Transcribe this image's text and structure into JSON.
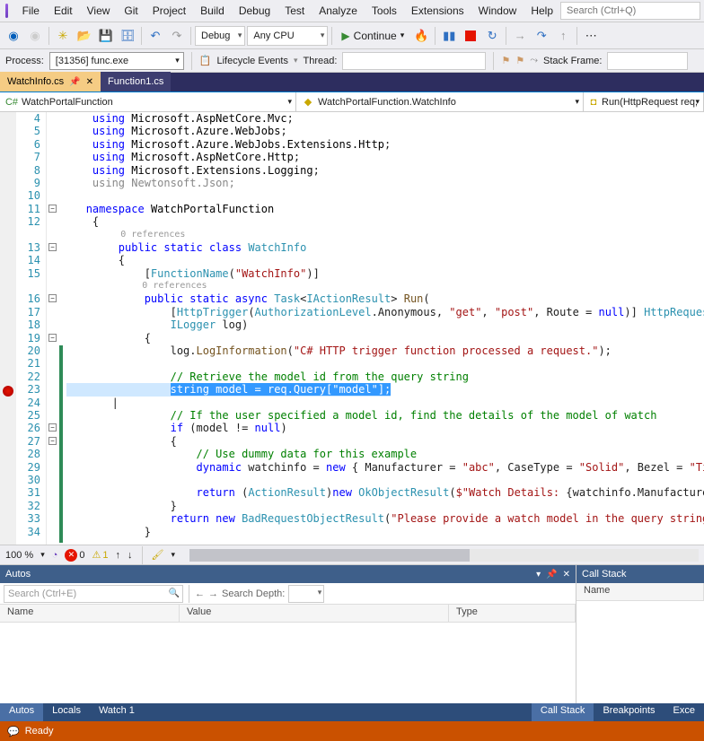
{
  "menu": [
    "File",
    "Edit",
    "View",
    "Git",
    "Project",
    "Build",
    "Debug",
    "Test",
    "Analyze",
    "Tools",
    "Extensions",
    "Window",
    "Help"
  ],
  "search_placeholder": "Search (Ctrl+Q)",
  "toolbar": {
    "config": "Debug",
    "platform": "Any CPU",
    "continue": "Continue"
  },
  "process": {
    "label": "Process:",
    "value": "[31356] func.exe",
    "lifecycle_label": "Lifecycle Events",
    "thread_label": "Thread:",
    "stack_label": "Stack Frame:"
  },
  "tabs": [
    {
      "name": "WatchInfo.cs",
      "active": true
    },
    {
      "name": "Function1.cs",
      "active": false
    }
  ],
  "dropdowns": {
    "namespace": "WatchPortalFunction",
    "class": "WatchPortalFunction.WatchInfo",
    "method": "Run(HttpRequest req,"
  },
  "code": {
    "first_line": 4,
    "breakpoint_line": 23,
    "change_bar_start": 20,
    "change_bar_end": 34,
    "lines": [
      {
        "n": 4,
        "t": "    using Microsoft.AspNetCore.Mvc;",
        "cls": "u"
      },
      {
        "n": 5,
        "t": "    using Microsoft.Azure.WebJobs;",
        "cls": "u"
      },
      {
        "n": 6,
        "t": "    using Microsoft.Azure.WebJobs.Extensions.Http;",
        "cls": "u"
      },
      {
        "n": 7,
        "t": "    using Microsoft.AspNetCore.Http;",
        "cls": "u"
      },
      {
        "n": 8,
        "t": "    using Microsoft.Extensions.Logging;",
        "cls": "u"
      },
      {
        "n": 9,
        "t": "    using Newtonsoft.Json;",
        "cls": "ug"
      },
      {
        "n": 10,
        "t": ""
      },
      {
        "n": 11,
        "t": "   ⊟namespace WatchPortalFunction",
        "cls": "ns"
      },
      {
        "n": 12,
        "t": "    {"
      },
      {
        "n": 0,
        "t": "          0 references",
        "cls": "ref"
      },
      {
        "n": 13,
        "t": "        public static class WatchInfo",
        "cls": "cls"
      },
      {
        "n": 14,
        "t": "        {"
      },
      {
        "n": 15,
        "t": "            [FunctionName(\"WatchInfo\")]",
        "cls": "attr"
      },
      {
        "n": 0,
        "t": "              0 references",
        "cls": "ref"
      },
      {
        "n": 16,
        "t": "            public static async Task<IActionResult> Run(",
        "cls": "sig"
      },
      {
        "n": 17,
        "t": "                [HttpTrigger(AuthorizationLevel.Anonymous, \"get\", \"post\", Route = null)] HttpRequest req,",
        "cls": "p1"
      },
      {
        "n": 18,
        "t": "                ILogger log)",
        "cls": "p2"
      },
      {
        "n": 19,
        "t": "            {"
      },
      {
        "n": 20,
        "t": "                log.LogInformation(\"C# HTTP trigger function processed a request.\");",
        "cls": "b1"
      },
      {
        "n": 21,
        "t": ""
      },
      {
        "n": 22,
        "t": "                // Retrieve the model id from the query string",
        "cls": "c"
      },
      {
        "n": 23,
        "t": "                string model = req.Query[\"model\"];",
        "cls": "hl"
      },
      {
        "n": 24,
        "t": "       |"
      },
      {
        "n": 25,
        "t": "                // If the user specified a model id, find the details of the model of watch",
        "cls": "c"
      },
      {
        "n": 26,
        "t": "                if (model != null)",
        "cls": "if"
      },
      {
        "n": 27,
        "t": "                {"
      },
      {
        "n": 28,
        "t": "                    // Use dummy data for this example",
        "cls": "c"
      },
      {
        "n": 29,
        "t": "                    dynamic watchinfo = new { Manufacturer = \"abc\", CaseType = \"Solid\", Bezel = \"Titanium\",",
        "cls": "dyn"
      },
      {
        "n": 30,
        "t": ""
      },
      {
        "n": 31,
        "t": "                    return (ActionResult)new OkObjectResult($\"Watch Details: {watchinfo.Manufacturer}, {wat",
        "cls": "ret1"
      },
      {
        "n": 32,
        "t": "                }"
      },
      {
        "n": 33,
        "t": "                return new BadRequestObjectResult(\"Please provide a watch model in the query string\");",
        "cls": "ret2"
      },
      {
        "n": 34,
        "t": "            }"
      }
    ]
  },
  "code_footer": {
    "zoom": "100 %",
    "errors": "0",
    "warnings": "1"
  },
  "autos": {
    "title": "Autos",
    "search_placeholder": "Search (Ctrl+E)",
    "depth_label": "Search Depth:",
    "cols": [
      "Name",
      "Value",
      "Type"
    ]
  },
  "callstack": {
    "title": "Call Stack",
    "col": "Name"
  },
  "bottom_tabs_left": [
    "Autos",
    "Locals",
    "Watch 1"
  ],
  "bottom_tabs_right": [
    "Call Stack",
    "Breakpoints",
    "Exce"
  ],
  "status": "Ready"
}
